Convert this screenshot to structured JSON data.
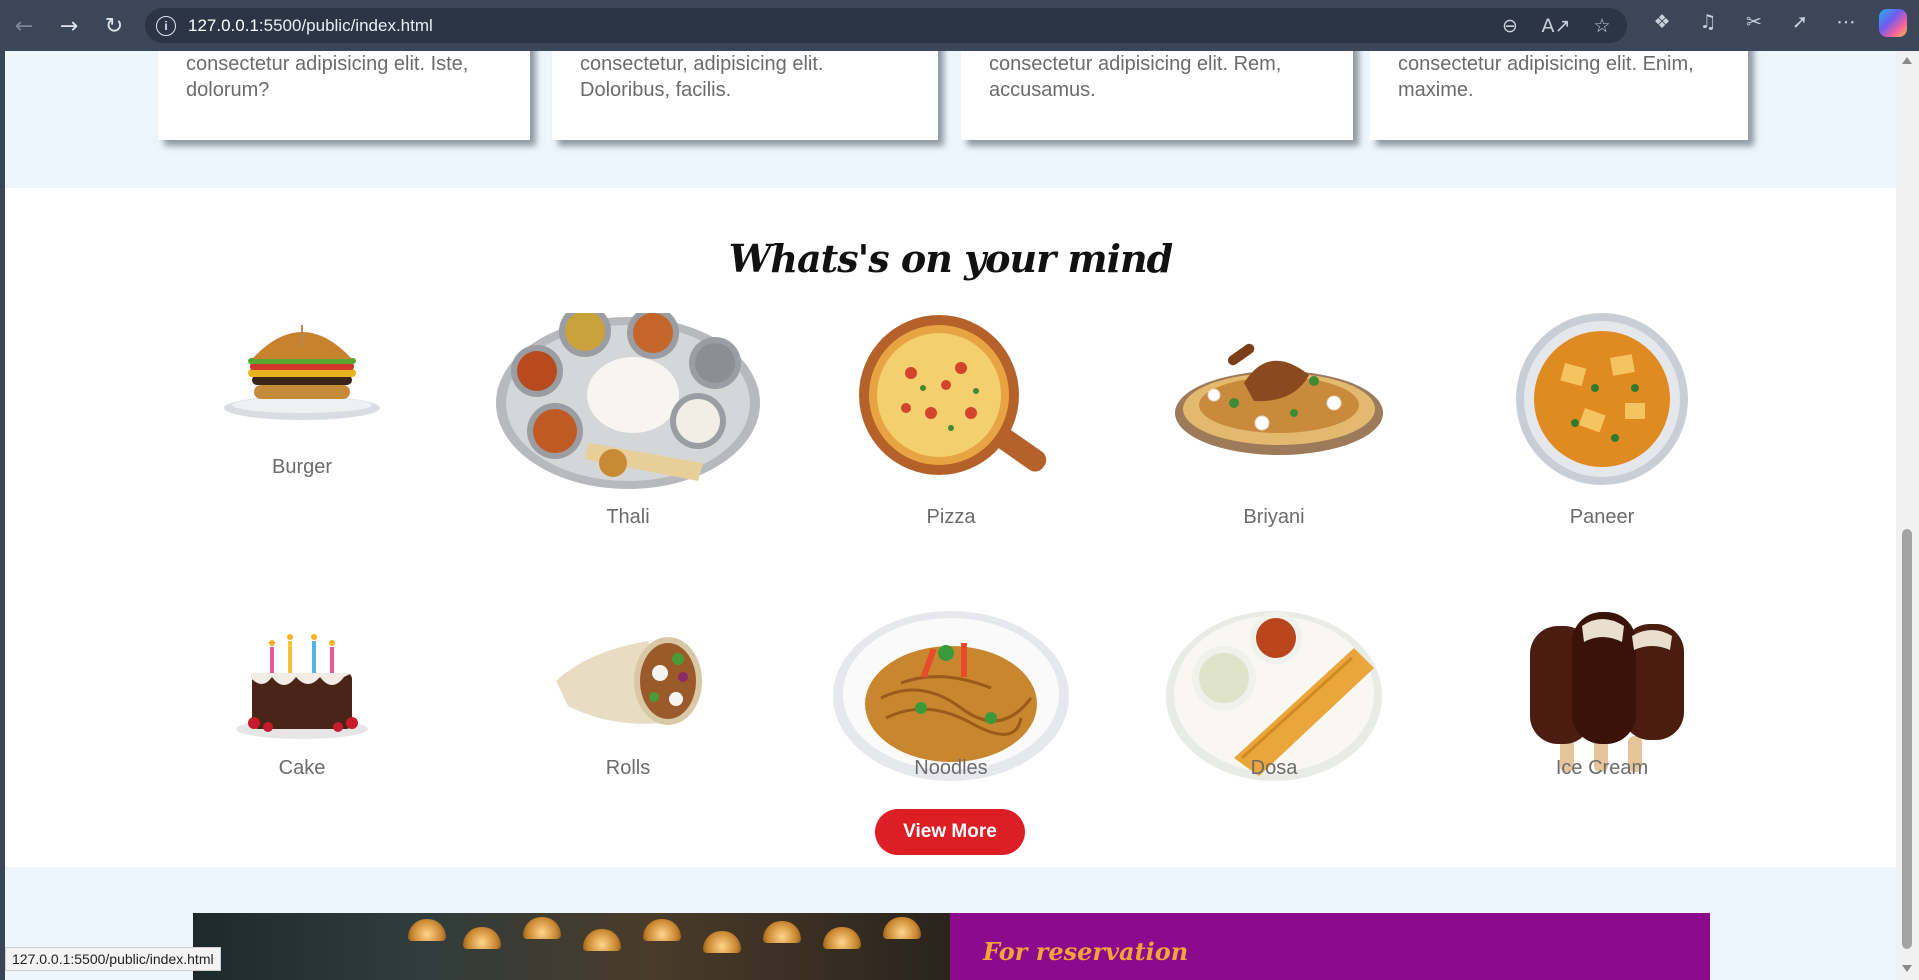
{
  "browser": {
    "url_host": "127.0.0.1",
    "url_rest": ":5500/public/index.html",
    "status_url": "127.0.0.1:5500/public/index.html"
  },
  "features": {
    "cards": [
      {
        "line1": "consectetur adipisicing elit. Iste,",
        "line2": "dolorum?"
      },
      {
        "line1": "consectetur, adipisicing elit.",
        "line2": "Doloribus, facilis."
      },
      {
        "line1": "consectetur adipisicing elit. Rem,",
        "line2": "accusamus."
      },
      {
        "line1": "consectetur adipisicing elit. Enim,",
        "line2": "maxime."
      }
    ]
  },
  "menu": {
    "title": "Whats's on your mind",
    "items": [
      {
        "label": "Burger",
        "icon": "burger-icon"
      },
      {
        "label": "Thali",
        "icon": "thali-icon"
      },
      {
        "label": "Pizza",
        "icon": "pizza-icon"
      },
      {
        "label": "Briyani",
        "icon": "briyani-icon"
      },
      {
        "label": "Paneer",
        "icon": "paneer-icon"
      },
      {
        "label": "Cake",
        "icon": "cake-icon"
      },
      {
        "label": "Rolls",
        "icon": "rolls-icon"
      },
      {
        "label": "Noodles",
        "icon": "noodles-icon"
      },
      {
        "label": "Dosa",
        "icon": "dosa-icon"
      },
      {
        "label": "Ice Cream",
        "icon": "ice-cream-icon"
      }
    ],
    "view_more": "View More"
  },
  "reservation": {
    "title": "For reservation"
  },
  "colors": {
    "accent_red": "#dd1f25",
    "reservation_purple": "#8b0a8e",
    "reservation_orange": "#f2a33a",
    "section_bg": "#eef6fd"
  }
}
